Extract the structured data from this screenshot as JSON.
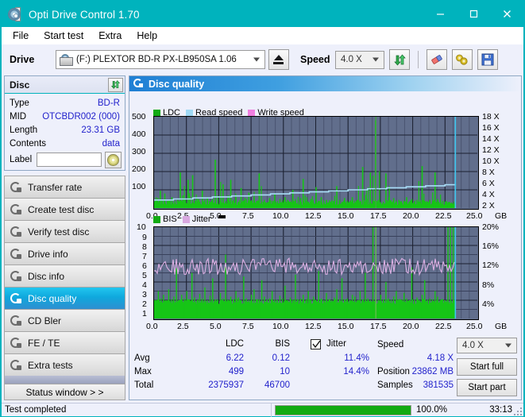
{
  "window": {
    "title": "Opti Drive Control 1.70",
    "icon": "disc-icon",
    "minimize": "–",
    "maximize": "□",
    "close": "✕"
  },
  "menu": {
    "items": [
      "File",
      "Start test",
      "Extra",
      "Help"
    ]
  },
  "toolbar": {
    "drive_label": "Drive",
    "drive_value": "(F:)   PLEXTOR BD-R  PX-LB950SA 1.06",
    "eject_icon": "eject-icon",
    "speed_label": "Speed",
    "speed_value": "4.0 X",
    "refresh_icon": "refresh-icon",
    "eraser_icon": "eraser-icon",
    "tools_icon": "tools-icon",
    "save_icon": "save-icon"
  },
  "disc": {
    "title": "Disc",
    "refresh_icon": "refresh-icon",
    "rows": [
      {
        "key": "Type",
        "value": "BD-R"
      },
      {
        "key": "MID",
        "value": "OTCBDR002 (000)"
      },
      {
        "key": "Length",
        "value": "23.31 GB"
      },
      {
        "key": "Contents",
        "value": "data"
      }
    ],
    "label_key": "Label",
    "label_value": "",
    "label_button_icon": "cd-icon"
  },
  "sidebar": {
    "items": [
      {
        "label": "Transfer rate",
        "icon": "disc-test-icon",
        "active": false
      },
      {
        "label": "Create test disc",
        "icon": "disc-test-icon",
        "active": false
      },
      {
        "label": "Verify test disc",
        "icon": "disc-test-icon",
        "active": false
      },
      {
        "label": "Drive info",
        "icon": "disc-test-icon",
        "active": false
      },
      {
        "label": "Disc info",
        "icon": "disc-test-icon",
        "active": false
      },
      {
        "label": "Disc quality",
        "icon": "disc-test-icon",
        "active": true
      },
      {
        "label": "CD Bler",
        "icon": "disc-test-icon",
        "active": false
      },
      {
        "label": "FE / TE",
        "icon": "disc-test-icon",
        "active": false
      },
      {
        "label": "Extra tests",
        "icon": "disc-test-icon",
        "active": false
      }
    ],
    "status_window": "Status window > >"
  },
  "panel": {
    "header_title": "Disc quality",
    "header_icon": "disc-quality-icon"
  },
  "stats": {
    "col_ldc": "LDC",
    "col_bis": "BIS",
    "col_jitter": "Jitter",
    "jitter_checked": true,
    "row_avg": "Avg",
    "row_max": "Max",
    "row_total": "Total",
    "ldc_avg": "6.22",
    "ldc_max": "499",
    "ldc_total": "2375937",
    "bis_avg": "0.12",
    "bis_max": "10",
    "bis_total": "46700",
    "jitter_avg": "11.4%",
    "jitter_max": "14.4%",
    "speed_label": "Speed",
    "speed_value": "4.18 X",
    "position_label": "Position",
    "position_value": "23862 MB",
    "samples_label": "Samples",
    "samples_value": "381535",
    "speed_select": "4.0 X",
    "start_full": "Start full",
    "start_part": "Start part"
  },
  "statusbar": {
    "text": "Test completed",
    "progress_percent": "100.0%",
    "progress_value": 100,
    "elapsed": "33:13"
  },
  "colors": {
    "titlebar": "#00b3bd",
    "ldc": "#12cc12",
    "bis": "#12cc12",
    "read_speed": "#9fd8f4",
    "write_speed": "#f07fe0",
    "jitter": "#d8a8e0",
    "plot_bg": "#616e8c",
    "value_text": "#2222cc",
    "progress": "#12aa12"
  },
  "chart_data": [
    {
      "type": "line",
      "name": "top-chart",
      "title": "",
      "xlabel": "GB",
      "ylabel": "",
      "legend": [
        {
          "label": "LDC",
          "color": "#12cc12"
        },
        {
          "label": "Read speed",
          "color": "#9fd8f4"
        },
        {
          "label": "Write speed",
          "color": "#f07fe0"
        }
      ],
      "legend_position": "top-left",
      "grid": true,
      "x_ticks": [
        "0.0",
        "2.5",
        "5.0",
        "7.5",
        "10.0",
        "12.5",
        "15.0",
        "17.5",
        "20.0",
        "22.5",
        "25.0"
      ],
      "x_unit": "GB",
      "xlim": [
        0,
        25
      ],
      "y_left_ticks": [
        100,
        200,
        300,
        400,
        500
      ],
      "ylim_left": [
        0,
        500
      ],
      "y_right_ticks": [
        "2 X",
        "4 X",
        "6 X",
        "8 X",
        "10 X",
        "12 X",
        "14 X",
        "16 X",
        "18 X"
      ],
      "ylim_right": [
        0,
        18
      ],
      "series": [
        {
          "name": "LDC",
          "color": "#12cc12",
          "render": "bars",
          "x": [
            0.05,
            0.25,
            0.45,
            0.6,
            0.8,
            1.0,
            1.15,
            1.35,
            1.55,
            1.8,
            2.0,
            2.2,
            2.4,
            2.6,
            2.75,
            2.95,
            3.15,
            3.35,
            3.5,
            3.7,
            3.9,
            4.1,
            4.3,
            4.5,
            4.7,
            4.9,
            5.1,
            5.3,
            5.5,
            5.7,
            5.9,
            6.1,
            6.3,
            6.5,
            6.7,
            6.9,
            7.1,
            7.3,
            7.5,
            7.7,
            7.9,
            8.1,
            8.3,
            8.5,
            8.7,
            8.9,
            9.1,
            9.3,
            9.5,
            9.7,
            9.9,
            10.1,
            10.3,
            10.5,
            10.7,
            10.9,
            11.1,
            11.3,
            11.5,
            11.7,
            11.9,
            12.1,
            12.3,
            12.5,
            12.7,
            12.9,
            13.1,
            13.3,
            13.5,
            13.7,
            13.9,
            14.1,
            14.3,
            14.5,
            14.7,
            14.9,
            15.1,
            15.3,
            15.5,
            15.7,
            15.9,
            16.1,
            16.3,
            16.5,
            16.7,
            16.9,
            17.1,
            17.3,
            17.5,
            17.7,
            17.9,
            18.1,
            18.3,
            18.5,
            18.7,
            18.9,
            19.1,
            19.3,
            19.5,
            19.7,
            19.9,
            20.1,
            20.3,
            20.5,
            20.7,
            20.9,
            21.1,
            21.3,
            21.5,
            21.7,
            21.9,
            22.1,
            22.3,
            22.5,
            22.7,
            22.9,
            23.1,
            23.25
          ],
          "values": [
            40,
            55,
            95,
            40,
            80,
            40,
            35,
            60,
            30,
            45,
            195,
            70,
            45,
            155,
            60,
            180,
            40,
            50,
            35,
            95,
            45,
            60,
            30,
            50,
            265,
            55,
            40,
            130,
            35,
            70,
            155,
            45,
            60,
            35,
            110,
            40,
            50,
            85,
            35,
            60,
            40,
            190,
            35,
            45,
            30,
            55,
            40,
            75,
            30,
            50,
            35,
            60,
            45,
            35,
            100,
            40,
            30,
            55,
            160,
            40,
            35,
            50,
            30,
            115,
            40,
            60,
            35,
            45,
            30,
            40,
            35,
            120,
            45,
            30,
            55,
            40,
            35,
            60,
            30,
            45,
            40,
            225,
            35,
            50,
            195,
            40,
            480,
            45,
            30,
            35,
            190,
            40,
            30,
            55,
            35,
            45,
            30,
            40,
            60,
            35,
            50,
            30,
            45,
            35,
            230,
            40,
            30,
            45,
            35,
            195,
            50,
            30,
            40,
            35,
            30,
            25,
            20,
            15
          ]
        },
        {
          "name": "Read speed",
          "color": "#9fd8f4",
          "render": "line",
          "x": [
            0.0,
            1.5,
            3.0,
            4.5,
            6.0,
            7.5,
            9.0,
            10.5,
            12.0,
            13.5,
            15.0,
            16.5,
            18.0,
            19.5,
            21.0,
            22.5,
            23.3,
            23.3
          ],
          "values": [
            1.6,
            1.8,
            2.0,
            2.2,
            2.4,
            2.6,
            2.8,
            3.0,
            3.2,
            3.4,
            3.6,
            3.8,
            4.0,
            4.2,
            4.4,
            4.6,
            4.7,
            18.0
          ]
        }
      ]
    },
    {
      "type": "line",
      "name": "bottom-chart",
      "title": "",
      "xlabel": "GB",
      "ylabel": "",
      "legend": [
        {
          "label": "BIS",
          "color": "#12cc12"
        },
        {
          "label": "Jitter",
          "color": "#d8a8e0"
        }
      ],
      "legend_position": "top-left",
      "grid": true,
      "x_ticks": [
        "0.0",
        "2.5",
        "5.0",
        "7.5",
        "10.0",
        "12.5",
        "15.0",
        "17.5",
        "20.0",
        "22.5",
        "25.0"
      ],
      "x_unit": "GB",
      "xlim": [
        0,
        25
      ],
      "y_left_ticks": [
        1,
        2,
        3,
        4,
        5,
        6,
        7,
        8,
        9,
        10
      ],
      "ylim_left": [
        0,
        10
      ],
      "y_right_ticks": [
        "4%",
        "8%",
        "12%",
        "16%",
        "20%"
      ],
      "ylim_right": [
        0,
        20
      ],
      "series": [
        {
          "name": "BIS",
          "color": "#12cc12",
          "render": "bars",
          "baseline": 1.6,
          "x": [
            0.1,
            0.3,
            0.5,
            0.7,
            0.9,
            1.1,
            1.3,
            1.5,
            1.7,
            1.9,
            2.1,
            2.3,
            2.5,
            2.7,
            2.9,
            3.1,
            3.3,
            3.5,
            3.7,
            3.9,
            4.1,
            4.3,
            4.5,
            4.7,
            4.9,
            5.1,
            5.3,
            5.5,
            5.7,
            5.9,
            6.1,
            6.3,
            6.5,
            6.7,
            6.9,
            7.1,
            7.3,
            7.5,
            7.7,
            7.9,
            8.1,
            8.3,
            8.5,
            8.7,
            8.9,
            9.1,
            9.3,
            9.5,
            9.7,
            9.9,
            10.1,
            10.3,
            10.5,
            10.7,
            10.9,
            11.1,
            11.3,
            11.5,
            11.7,
            11.9,
            12.1,
            12.3,
            12.5,
            12.7,
            12.9,
            13.1,
            13.3,
            13.5,
            13.7,
            13.9,
            14.1,
            14.3,
            14.5,
            14.7,
            14.9,
            15.1,
            15.3,
            15.5,
            15.7,
            15.9,
            16.1,
            16.3,
            16.5,
            16.7,
            16.9,
            17.1,
            17.3,
            17.5,
            17.7,
            17.9,
            18.1,
            18.3,
            18.5,
            18.7,
            18.9,
            19.1,
            19.3,
            19.5,
            19.7,
            19.9,
            20.1,
            20.3,
            20.5,
            20.7,
            20.9,
            21.1,
            21.3,
            21.5,
            21.7,
            21.9,
            22.1,
            22.3,
            22.5,
            22.7,
            22.9,
            23.1,
            23.25
          ],
          "values": [
            2.0,
            3.0,
            2.2,
            2.6,
            2.0,
            3.2,
            2.1,
            2.4,
            5.5,
            2.0,
            2.6,
            2.2,
            3.0,
            2.1,
            5.0,
            2.3,
            2.0,
            2.7,
            2.2,
            3.4,
            2.0,
            2.5,
            4.4,
            2.1,
            2.0,
            2.8,
            2.2,
            7.0,
            2.0,
            2.4,
            2.1,
            3.0,
            2.3,
            2.0,
            4.6,
            2.2,
            2.0,
            2.6,
            3.2,
            2.1,
            2.0,
            4.2,
            2.4,
            2.0,
            2.2,
            3.0,
            2.1,
            2.0,
            2.5,
            2.2,
            3.6,
            2.0,
            2.3,
            2.1,
            4.8,
            2.0,
            2.2,
            2.6,
            2.0,
            3.0,
            2.1,
            2.4,
            2.0,
            5.2,
            2.2,
            2.0,
            2.8,
            2.1,
            2.0,
            2.3,
            3.2,
            2.0,
            4.4,
            2.1,
            2.2,
            2.0,
            2.6,
            2.4,
            2.0,
            3.0,
            2.1,
            5.0,
            2.2,
            2.0,
            10.0,
            2.3,
            2.0,
            2.6,
            2.1,
            4.0,
            2.2,
            2.0,
            2.4,
            3.0,
            2.1,
            2.0,
            2.8,
            2.2,
            2.0,
            5.6,
            2.1,
            2.3,
            2.0,
            2.6,
            4.2,
            2.0,
            2.2,
            2.1,
            3.0,
            2.4,
            2.0,
            2.1,
            1.8
          ]
        },
        {
          "name": "Jitter",
          "color": "#d8a8e0",
          "render": "line",
          "mean": 5.7,
          "amplitude": 0.9,
          "percent_mean": "11.4%"
        }
      ]
    }
  ]
}
